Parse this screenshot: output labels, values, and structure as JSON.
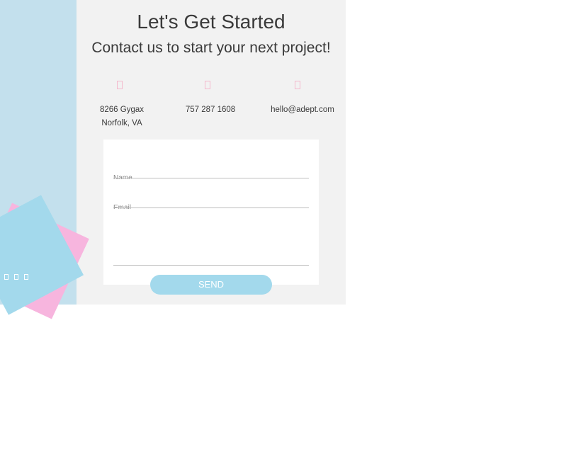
{
  "header": {
    "title": "Let's Get Started",
    "subtitle": "Contact us to start your next project!"
  },
  "contact": {
    "address_line1": "8266 Gygax",
    "address_line2": "Norfolk, VA",
    "phone": "757 287 1608",
    "email": "hello@adept.com",
    "icons": [
      "location-icon",
      "phone-icon",
      "email-icon"
    ],
    "icon_color": "#f4b8cc"
  },
  "form": {
    "name_label": "Name",
    "email_label": "Email",
    "send_label": "SEND"
  },
  "social": {
    "icons": [
      "social-icon-1",
      "social-icon-2",
      "social-icon-3"
    ]
  },
  "colors": {
    "accent_blue": "#a3d9ec",
    "side_blue": "#c3e0ed",
    "accent_pink": "#f7b5de",
    "panel_gray": "#f2f2f2",
    "text": "#3a3a3a"
  }
}
